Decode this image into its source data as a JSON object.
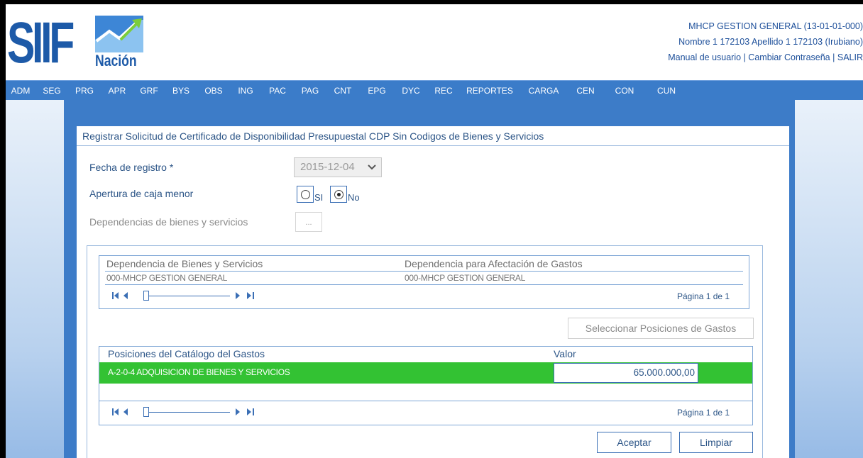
{
  "header": {
    "logo_main": "SIIF",
    "logo_sub": "Nación",
    "org": "MHCP GESTION GENERAL (13-01-01-000)",
    "user": "Nombre 1 172103 Apellido 1 172103 (Irubiano)",
    "links": [
      "Manual de usuario",
      "Cambiar Contraseña",
      "SALIR"
    ],
    "link_separator": "|"
  },
  "menu": {
    "items": [
      "ADM",
      "SEG",
      "PRG",
      "APR",
      "GRF",
      "BYS",
      "OBS",
      "ING",
      "PAC",
      "PAG",
      "CNT",
      "EPG",
      "DYC",
      "REC",
      "REPORTES",
      "CARGA",
      "CEN",
      "CON",
      "CUN"
    ]
  },
  "form": {
    "title": "Registrar Solicitud de Certificado de Disponibilidad Presupuestal CDP Sin Codigos de Bienes y Servicios",
    "fecha_label": "Fecha de registro *",
    "fecha_value": "2015-12-04",
    "caja_label": "Apertura de caja menor",
    "radio_si": "SI",
    "radio_no": "No",
    "radio_selected": "No",
    "dependencias_label": "Dependencias de bienes y servicios",
    "dots_button": "..."
  },
  "grid_dependencias": {
    "headers": [
      "Dependencia de Bienes y Servicios",
      "Dependencia para Afectación de Gastos"
    ],
    "rows": [
      [
        "000-MHCP GESTION GENERAL",
        "000-MHCP GESTION GENERAL"
      ]
    ],
    "pagination": "Página 1 de 1"
  },
  "select_positions_button": "Seleccionar Posiciones de Gastos",
  "grid_posiciones": {
    "headers": [
      "Posiciones del Catálogo del Gastos",
      "Valor"
    ],
    "rows": [
      {
        "code": "A-2-0-4 ADQUISICION DE BIENES Y SERVICIOS",
        "valor": "65.000.000,00"
      }
    ],
    "pagination": "Página 1 de 1",
    "row_color": "#33c233"
  },
  "actions": {
    "accept": "Aceptar",
    "clear": "Limpiar"
  },
  "colors": {
    "brand": "#1d5aa8",
    "menubar": "#3b7cc9",
    "text": "#2c5587"
  }
}
